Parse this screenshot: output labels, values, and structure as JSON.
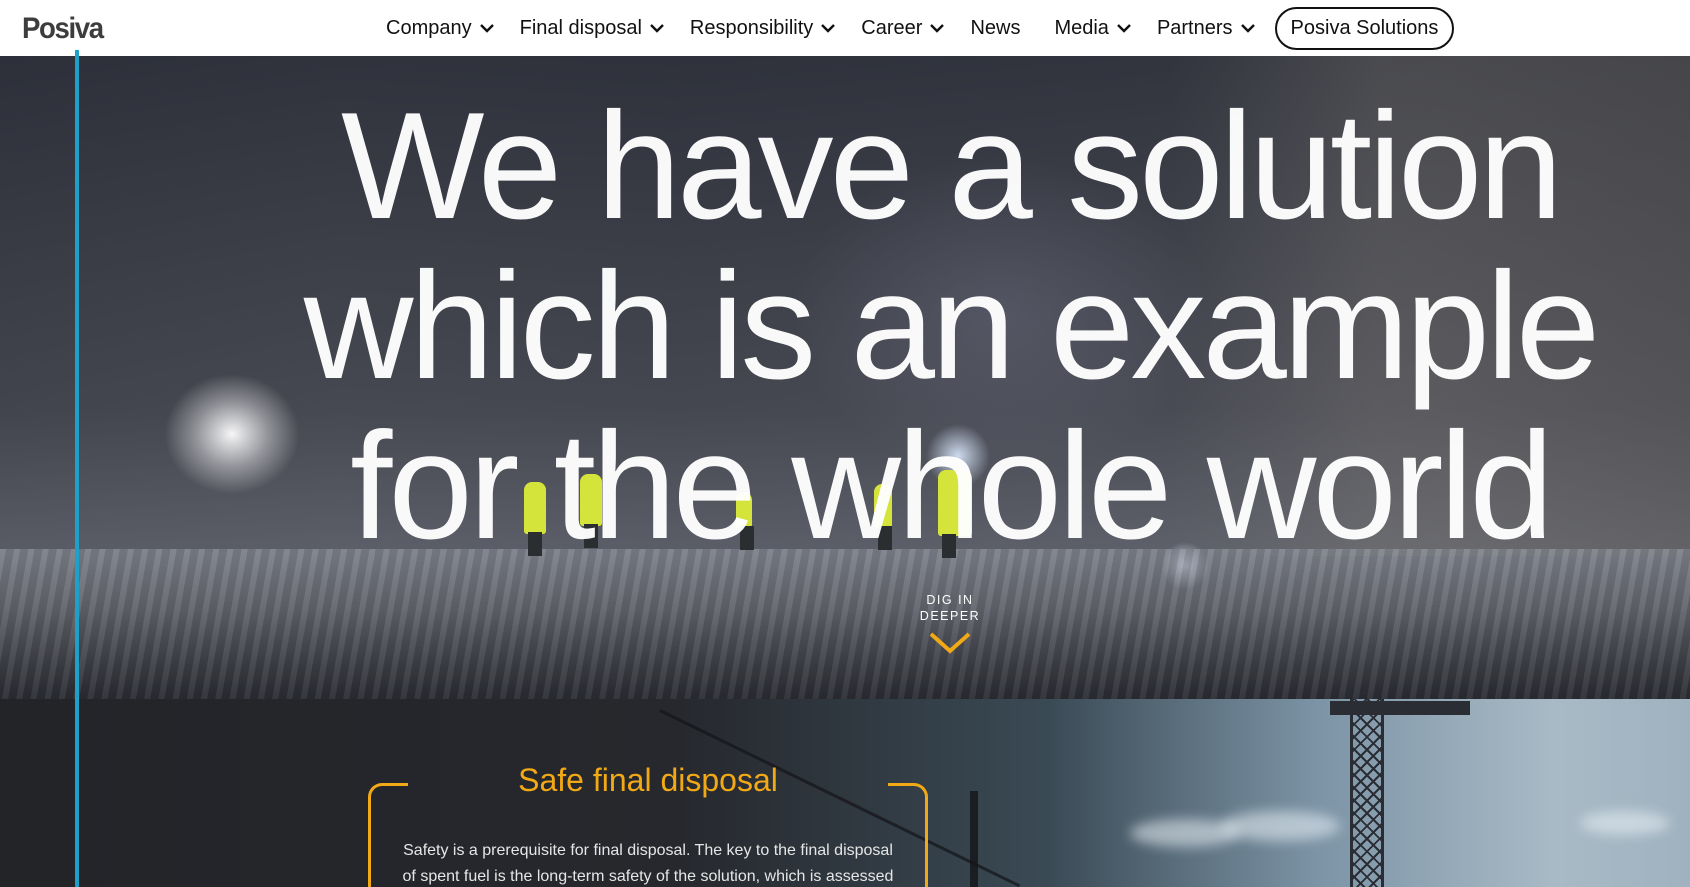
{
  "header": {
    "logo": "Posiva",
    "nav": [
      {
        "label": "Company",
        "has_dropdown": true
      },
      {
        "label": "Final disposal",
        "has_dropdown": true
      },
      {
        "label": "Responsibility",
        "has_dropdown": true
      },
      {
        "label": "Career",
        "has_dropdown": true
      },
      {
        "label": "News",
        "has_dropdown": false
      },
      {
        "label": "Media",
        "has_dropdown": true
      },
      {
        "label": "Partners",
        "has_dropdown": true
      }
    ],
    "cta": "Posiva Solutions"
  },
  "hero": {
    "title_lines": [
      "We have a solution",
      "which is an example",
      "for the whole world"
    ],
    "dig_line1": "DIG IN",
    "dig_line2": "DEEPER"
  },
  "section": {
    "title": "Safe final disposal",
    "text": "Safety is a prerequisite for final disposal. The key to the final disposal of spent fuel is the long-term safety of the solution, which is assessed"
  },
  "colors": {
    "accent": "#f2a916",
    "line": "#1ea0c8",
    "header_bg": "#ffffff"
  },
  "icons": {
    "dropdown": "chevron-down-icon",
    "scroll": "chevron-down-icon"
  }
}
